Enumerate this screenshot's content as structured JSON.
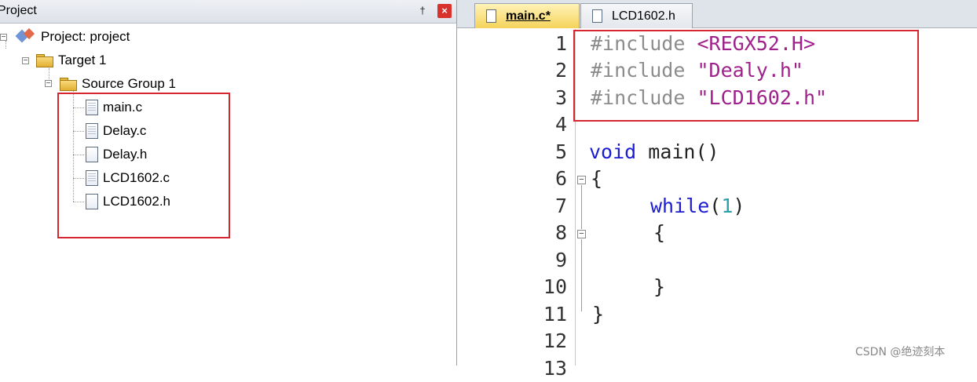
{
  "project_panel": {
    "title": "Project",
    "pin_glyph": "†",
    "close_glyph": "×",
    "tree": {
      "project": "Project: project",
      "target": "Target 1",
      "group": "Source Group 1",
      "files": [
        "main.c",
        "Delay.c",
        "Delay.h",
        "LCD1602.c",
        "LCD1602.h"
      ]
    }
  },
  "editor": {
    "tabs": [
      {
        "label": "main.c*",
        "active": true
      },
      {
        "label": "LCD1602.h",
        "active": false
      }
    ],
    "line_numbers": [
      "1",
      "2",
      "3",
      "4",
      "5",
      "6",
      "7",
      "8",
      "9",
      "10",
      "11",
      "12",
      "13"
    ],
    "code": {
      "l1_kw": "#include",
      "l1_str": "<REGX52.H>",
      "l2_kw": "#include",
      "l2_str": "\"Dealy.h\"",
      "l3_kw": "#include",
      "l3_str": "\"LCD1602.h\"",
      "l5_type": "void",
      "l5_rest": " main()",
      "l6": "{",
      "l7_kw": "while",
      "l7_open": "(",
      "l7_num": "1",
      "l7_close": ")",
      "l8": "{",
      "l10": "}",
      "l11": "}"
    }
  },
  "watermark": "CSDN @绝迹刻本",
  "colors": {
    "highlight_box": "#d6262f",
    "keyword": "#1c1cd2",
    "string": "#a0208c",
    "preprocessor": "#8c8c8c",
    "number": "#2aa0a8"
  }
}
